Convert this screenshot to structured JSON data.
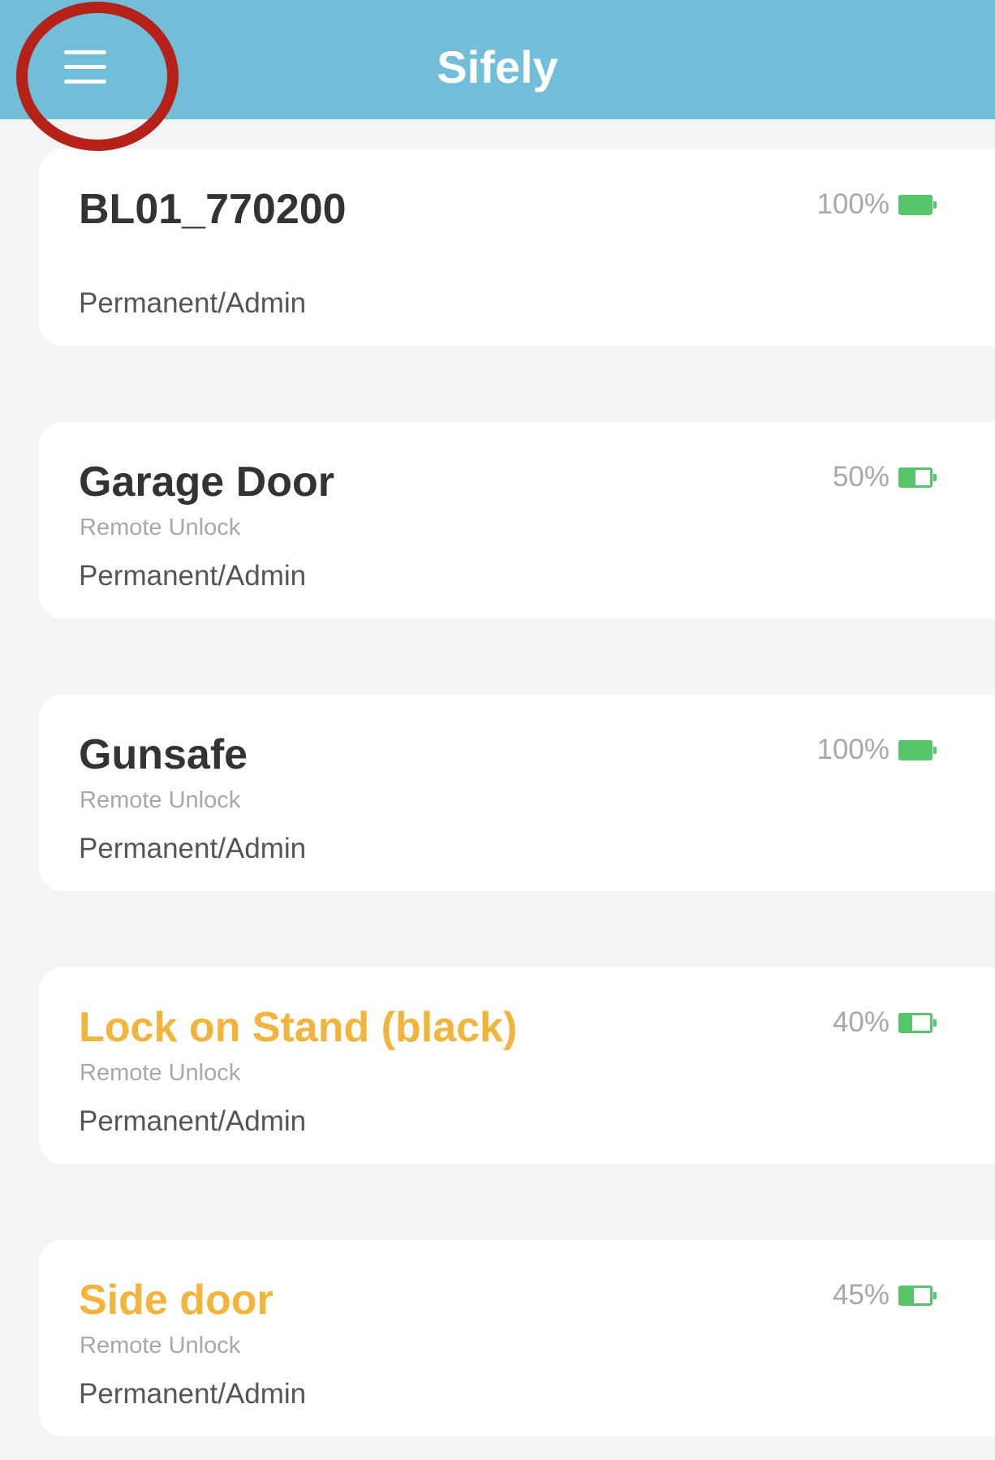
{
  "header": {
    "title": "Sifely",
    "menu_icon": "hamburger-menu-icon",
    "background_color": "#72bed8"
  },
  "colors": {
    "warning_name": "#f1b43c",
    "battery": "#55c46a",
    "highlight_ring": "#b5221a"
  },
  "locks": [
    {
      "name": "BL01_770200",
      "feature": "",
      "access": "Permanent/Admin",
      "battery_text": "100%",
      "battery_level": 1.0,
      "low_battery": false
    },
    {
      "name": "Garage Door",
      "feature": "Remote Unlock",
      "access": "Permanent/Admin",
      "battery_text": "50%",
      "battery_level": 0.5,
      "low_battery": false
    },
    {
      "name": "Gunsafe",
      "feature": "Remote Unlock",
      "access": "Permanent/Admin",
      "battery_text": "100%",
      "battery_level": 1.0,
      "low_battery": false
    },
    {
      "name": "Lock on Stand (black)",
      "feature": "Remote Unlock",
      "access": "Permanent/Admin",
      "battery_text": "40%",
      "battery_level": 0.4,
      "low_battery": true
    },
    {
      "name": "Side door",
      "feature": "Remote Unlock",
      "access": "Permanent/Admin",
      "battery_text": "45%",
      "battery_level": 0.45,
      "low_battery": true
    }
  ]
}
